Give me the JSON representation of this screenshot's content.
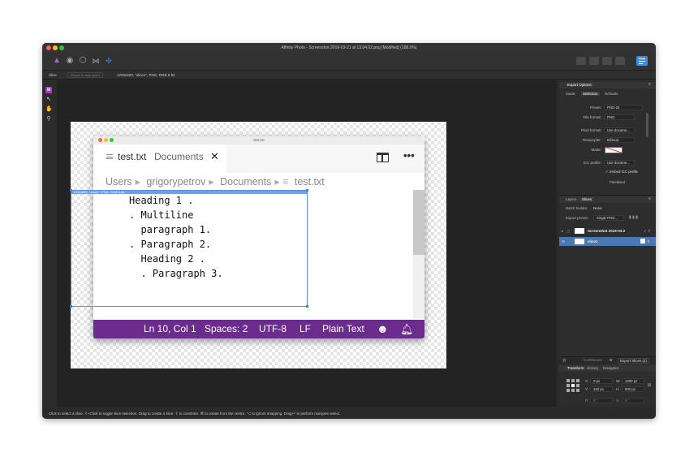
{
  "window": {
    "title": "Affinity Photo - Screenshot 2019-03-21 at 13.04.02.png [Modified] (108.0%)"
  },
  "toolbar": {
    "persona_icons": [
      "photo-persona-icon",
      "liquify-persona-icon",
      "develop-persona-icon",
      "tone-mapping-persona-icon",
      "export-persona-icon"
    ]
  },
  "context": {
    "tool_name": "Slice",
    "reset_label": "Revert to auto sized",
    "slice_info": "1200x600, \"slice1\", PNG, RGB 8-bit"
  },
  "editor": {
    "title": "test.txt",
    "tab_file": "test.txt",
    "tab_dir": "Documents",
    "tab_close": "✕",
    "more": "•••",
    "breadcrumbs": [
      "Users",
      "grigorypetrov",
      "Documents",
      "test.txt"
    ],
    "lines": [
      "Heading 1 .",
      ". Multiline",
      "  paragraph 1.",
      ". Paragraph 2.",
      "  Heading 2 .",
      "  . Paragraph 3."
    ],
    "status": {
      "position": "Ln 10, Col 1",
      "spaces": "Spaces: 2",
      "encoding": "UTF-8",
      "eol": "LF",
      "language": "Plain Text"
    },
    "slice_label": "1200x600, \"slice1\", PNG, RGB 8-bit"
  },
  "export_panel": {
    "title": "Export Options",
    "mode_label": "Mode:",
    "mode_tabs": [
      "Selection",
      "Defaults"
    ],
    "preset_label": "Preset:",
    "preset_value": "PNG-24",
    "format_label": "File format:",
    "format_value": "PNG",
    "pixel_label": "Pixel format:",
    "pixel_value": "Use docume...",
    "resampler_label": "Resampler:",
    "resampler_value": "Bilinear",
    "matte_label": "Matte:",
    "icc_label": "ICC profile:",
    "icc_value": "Use docume...",
    "embed_icc": "✓ Embed ICC profile",
    "palettised": "Palettised"
  },
  "slices_panel": {
    "tabs": [
      "Layers",
      "Slices"
    ],
    "batch_label": "Batch builder:",
    "batch_value": "None",
    "export_preset_label": "Export preset:",
    "export_preset_value": "Single PNG...",
    "rows": [
      {
        "name": "Screenshot 2019-03-2",
        "selected": false
      },
      {
        "name": "slice1",
        "selected": true
      }
    ],
    "continuous_label": "Continuous",
    "export_slices_label": "Export Slices (2)"
  },
  "transform_panel": {
    "tabs": [
      "Transform",
      "History",
      "Navigator"
    ],
    "x_label": "X:",
    "x_value": "0 px",
    "y_label": "Y:",
    "y_value": "340 px",
    "w_label": "W:",
    "w_value": "1200 px",
    "h_label": "H:",
    "h_value": "600 px",
    "r_label": "R:",
    "r_value": "0 °",
    "s_label": "S:",
    "s_value": "0 °"
  },
  "statusbar": {
    "text": "Click to select a slice. ⇧+Click to toggle slice selection. Drag to create a slice. ⇧ to constrain. ⌘ to create from the centre. ⌥ to ignore snapping. Drag+^ to perform marquee select."
  },
  "colors": {
    "accent": "#3d8de3",
    "status_purple": "#6b2c8d",
    "slice_blue": "#5a8ee0",
    "selected_row": "#4a78b5"
  }
}
